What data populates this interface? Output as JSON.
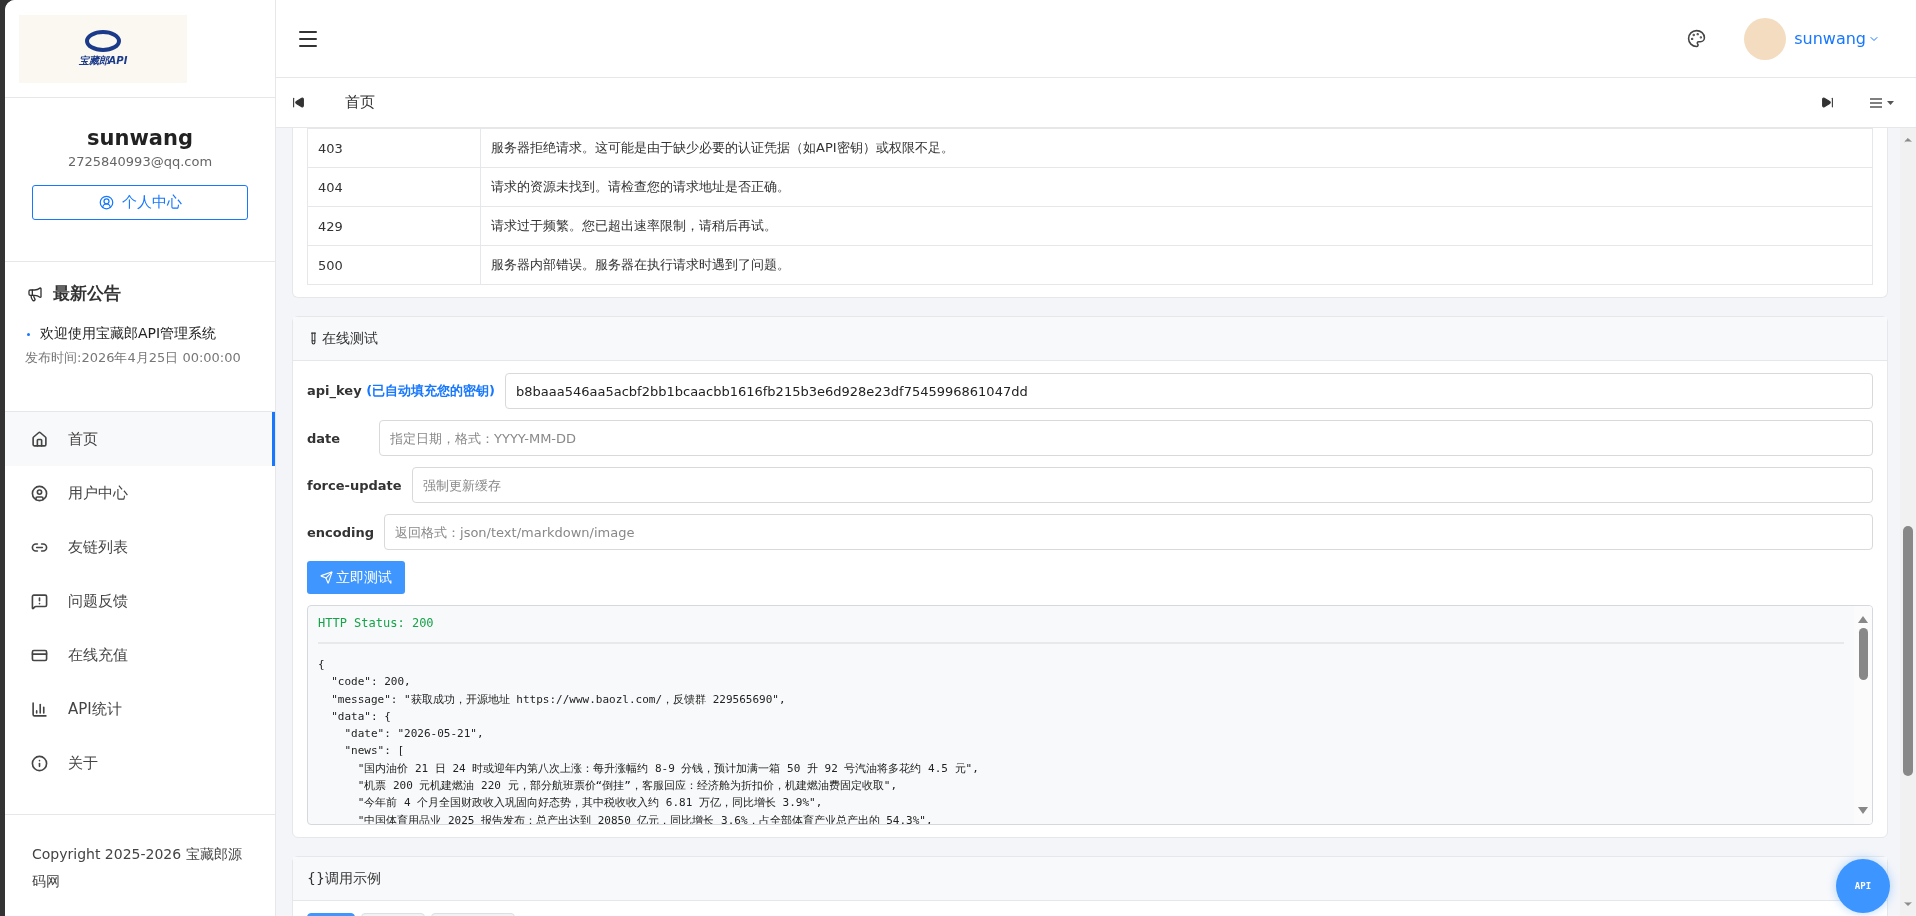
{
  "sidebar": {
    "logo_text": "宝藏郎API",
    "user": {
      "name": "sunwang",
      "email": "2725840993@qq.com",
      "button": "个人中心"
    },
    "announcement": {
      "title": "最新公告",
      "items": [
        {
          "text": "欢迎使用宝藏郎API管理系统",
          "time": "发布时间:2026年4月25日 00:00:00"
        }
      ]
    },
    "nav": [
      {
        "label": "首页",
        "selected": true
      },
      {
        "label": "用户中心",
        "selected": false
      },
      {
        "label": "友链列表",
        "selected": false
      },
      {
        "label": "问题反馈",
        "selected": false
      },
      {
        "label": "在线充值",
        "selected": false
      },
      {
        "label": "API统计",
        "selected": false
      },
      {
        "label": "关于",
        "selected": false
      }
    ],
    "footer": "Copyright 2025-2026 宝藏郎源码网"
  },
  "header": {
    "username": "sunwang"
  },
  "tabs": [
    {
      "label": "首页",
      "selected": true
    }
  ],
  "status_table": {
    "rows": [
      {
        "code": "403",
        "description": "服务器拒绝请求。这可能是由于缺少必要的认证凭据（如API密钥）或权限不足。"
      },
      {
        "code": "404",
        "description": "请求的资源未找到。请检查您的请求地址是否正确。"
      },
      {
        "code": "429",
        "description": "请求过于频繁。您已超出速率限制，请稍后再试。"
      },
      {
        "code": "500",
        "description": "服务器内部错误。服务器在执行请求时遇到了问题。"
      }
    ]
  },
  "online_test": {
    "title": "在线测试",
    "fields": [
      {
        "label": "api_key",
        "hint": "(已自动填充您的密钥)",
        "value": "b8baaa546aa5acbf2bb1bcaacbb1616fb215b3e6d928e23df7545996861047dd"
      },
      {
        "label": "date",
        "placeholder": "指定日期，格式：YYYY-MM-DD"
      },
      {
        "label": "force-update",
        "placeholder": "强制更新缓存"
      },
      {
        "label": "encoding",
        "placeholder": "返回格式：json/text/markdown/image"
      }
    ],
    "button": "立即测试",
    "response": {
      "status": "HTTP Status: 200",
      "lines": [
        "{",
        "  \"code\": 200,",
        "  \"message\": \"获取成功，开源地址 https://www.baozl.com/，反馈群 229565690\",",
        "  \"data\": {",
        "    \"date\": \"2026-05-21\",",
        "    \"news\": [",
        "      \"国内油价 21 日 24 时或迎年内第八次上涨：每升涨幅约 8-9 分钱，预计加满一箱 50 升 92 号汽油将多花约 4.5 元\",",
        "      \"机票 200 元机建燃油 220 元，部分航班票价“倒挂”，客服回应：经济舱为折扣价，机建燃油费固定收取\",",
        "      \"今年前 4 个月全国财政收入巩固向好态势，其中税收收入约 6.81 万亿，同比增长 3.9%\",",
        "      \"中国体育用品业 2025 报告发布：总产出达到 20850 亿元，同比增长 3.6%，占全部体育产业总产出的 54.3%\","
      ]
    }
  },
  "examples": {
    "title": "{}调用示例",
    "tabs": [
      {
        "selected": true
      },
      {
        "selected": false
      },
      {
        "selected": false
      }
    ]
  },
  "fab": "API"
}
